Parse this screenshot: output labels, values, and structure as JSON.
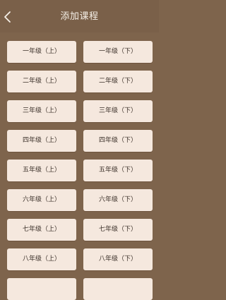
{
  "header": {
    "title": "添加课程",
    "back_icon": "chevron-left-icon"
  },
  "courses": [
    {
      "left": "一年级（上）",
      "right": "一年级（下）"
    },
    {
      "left": "二年级（上）",
      "right": "二年级（下）"
    },
    {
      "left": "三年级（上）",
      "right": "三年级（下）"
    },
    {
      "left": "四年级（上）",
      "right": "四年级（下）"
    },
    {
      "left": "五年级（上）",
      "right": "五年级（下）"
    },
    {
      "left": "六年级（上）",
      "right": "六年级（下）"
    },
    {
      "left": "七年级（上）",
      "right": "七年级（下）"
    },
    {
      "left": "八年级（上）",
      "right": "八年级（下）"
    },
    {
      "left": "",
      "right": ""
    }
  ],
  "colors": {
    "background": "#7e644c",
    "button": "#f5e8de",
    "button_text": "#3a2f28",
    "title_text": "#f5efe7"
  }
}
